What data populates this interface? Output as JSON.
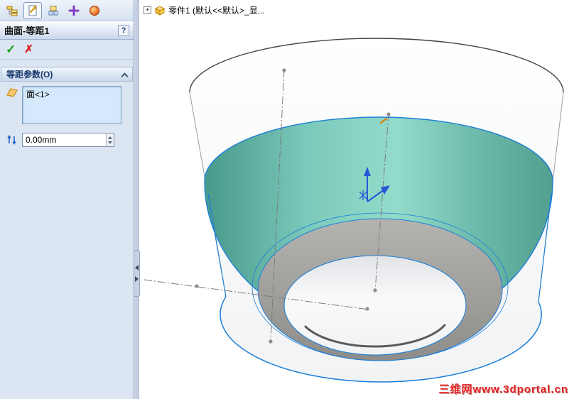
{
  "panel": {
    "title": "曲面-等距1",
    "group": {
      "title": "等距参数(O)",
      "selection_items": [
        "面<1>"
      ],
      "offset_value": "0.00mm"
    },
    "pm_tabs": [
      "featuremanager-tab",
      "propertymanager-tab",
      "configurationmanager-tab",
      "dimxpertmanager-tab",
      "displaymanager-tab"
    ]
  },
  "graphics": {
    "tree_item": "零件1 (默认<<默认>_显...",
    "watermark": "三维网www.3dportal.cn"
  },
  "icons": {
    "ok": "✓",
    "cancel": "✗",
    "help": "?",
    "expand": "+"
  },
  "colors": {
    "selected_face": "#6fc7b8",
    "edge_highlight": "#1b7fd8",
    "shoulder_face": "#a3a2a0",
    "panel_bg": "#dce6f3",
    "watermark_red": "#e21f1f"
  }
}
